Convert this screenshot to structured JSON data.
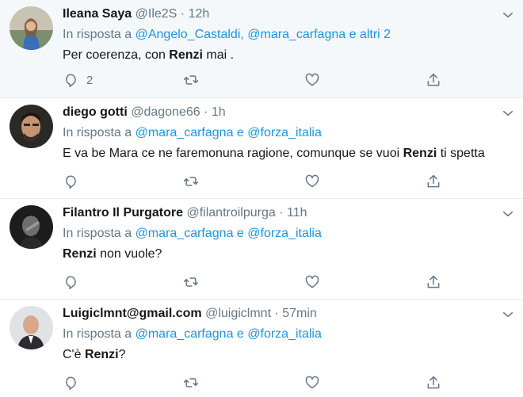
{
  "reply_prefix": "In risposta a",
  "tweets": [
    {
      "name": "Ileana Saya",
      "handle": "@Ile2S",
      "time": "12h",
      "reply_to": [
        "@Angelo_Castaldi,",
        "@mara_carfagna e altri 2"
      ],
      "text_before": "Per coerenza, con ",
      "text_bold": "Renzi",
      "text_after": " mai .",
      "reply_count": "2"
    },
    {
      "name": "diego gotti",
      "handle": "@dagone66",
      "time": "1h",
      "reply_to": [
        "@mara_carfagna e",
        "@forza_italia"
      ],
      "text_before": "E va be Mara ce ne faremonuna ragione, comunque se vuoi ",
      "text_bold": "Renzi",
      "text_after": " ti spetta",
      "reply_count": ""
    },
    {
      "name": "Filantro Il Purgatore",
      "handle": "@filantroilpurga",
      "time": "11h",
      "reply_to": [
        "@mara_carfagna e",
        "@forza_italia"
      ],
      "text_before": "",
      "text_bold": "Renzi",
      "text_after": " non vuole?",
      "reply_count": ""
    },
    {
      "name": "Luigiclmnt@gmail.com",
      "handle": "@luigiclmnt",
      "time": "57min",
      "reply_to": [
        "@mara_carfagna e",
        "@forza_italia"
      ],
      "text_before": "C'è ",
      "text_bold": "Renzi",
      "text_after": "?",
      "reply_count": ""
    }
  ],
  "icons": {
    "reply": "reply-icon",
    "retweet": "retweet-icon",
    "like": "like-icon",
    "share": "share-icon",
    "caret": "chevron-down-icon"
  },
  "colors": {
    "link": "#1b95e0",
    "secondary_text": "#657786",
    "highlight_bg": "#f5f8fa"
  }
}
